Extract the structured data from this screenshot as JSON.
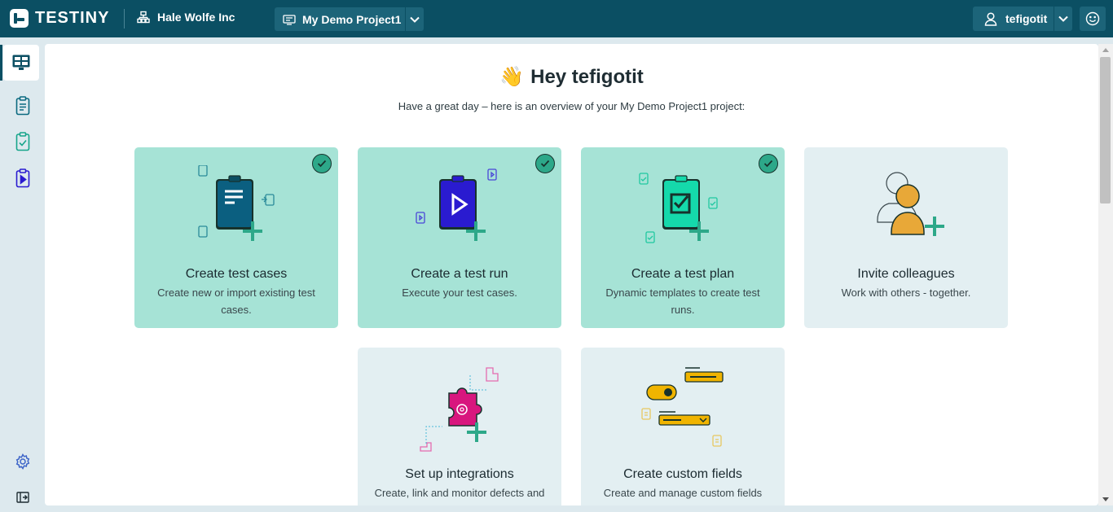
{
  "header": {
    "logo_text": "TESTINY",
    "organization": "Hale Wolfe Inc",
    "project": "My Demo Project1",
    "username": "tefigotit"
  },
  "sidebar": {
    "items": [
      {
        "name": "dashboard",
        "icon": "dashboard-icon",
        "active": true
      },
      {
        "name": "test-cases",
        "icon": "clipboard-icon"
      },
      {
        "name": "test-plans",
        "icon": "clipboard-check-icon"
      },
      {
        "name": "test-runs",
        "icon": "clipboard-play-icon"
      }
    ],
    "bottom": [
      {
        "name": "settings",
        "icon": "gear-icon"
      },
      {
        "name": "collapse",
        "icon": "collapse-sidebar-icon"
      }
    ]
  },
  "main": {
    "greeting": "Hey tefigotit",
    "greeting_emoji": "👋",
    "subtitle": "Have a great day – here is an overview of your My Demo Project1 project:",
    "cards": [
      {
        "title": "Create test cases",
        "description": "Create new or import existing test cases.",
        "done": true
      },
      {
        "title": "Create a test run",
        "description": "Execute your test cases.",
        "done": true
      },
      {
        "title": "Create a test plan",
        "description": "Dynamic templates to create test runs.",
        "done": true
      },
      {
        "title": "Invite colleagues",
        "description": "Work with others - together.",
        "done": false
      },
      {
        "title": "Set up integrations",
        "description": "Create, link and monitor defects and",
        "done": false
      },
      {
        "title": "Create custom fields",
        "description": "Create and manage custom fields",
        "done": false
      }
    ]
  },
  "colors": {
    "topbar": "#0b4f63",
    "card_done": "#a6e3d6",
    "card_todo": "#e3eff2",
    "accent_green": "#2da889"
  }
}
